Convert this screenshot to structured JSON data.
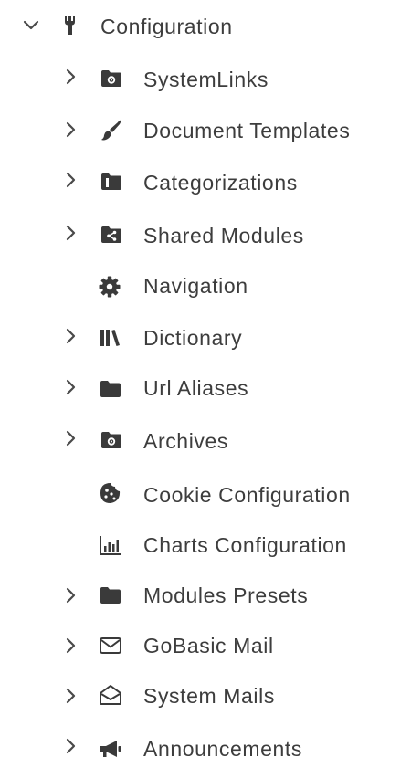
{
  "tree": {
    "root": {
      "label": "Configuration",
      "expanded": true,
      "icon": "wrench-icon"
    },
    "children": [
      {
        "label": "SystemLinks",
        "icon": "folder-gear-icon",
        "has_children": true
      },
      {
        "label": "Document Templates",
        "icon": "paintbrush-icon",
        "has_children": true
      },
      {
        "label": "Categorizations",
        "icon": "folder-tag-icon",
        "has_children": true
      },
      {
        "label": "Shared Modules",
        "icon": "folder-share-icon",
        "has_children": true
      },
      {
        "label": "Navigation",
        "icon": "gear-icon",
        "has_children": false
      },
      {
        "label": "Dictionary",
        "icon": "books-icon",
        "has_children": true
      },
      {
        "label": "Url Aliases",
        "icon": "folder-icon",
        "has_children": true
      },
      {
        "label": "Archives",
        "icon": "folder-gear-icon",
        "has_children": true
      },
      {
        "label": "Cookie Configuration",
        "icon": "cookie-icon",
        "has_children": false
      },
      {
        "label": "Charts Configuration",
        "icon": "bar-chart-icon",
        "has_children": false
      },
      {
        "label": "Modules Presets",
        "icon": "folder-icon",
        "has_children": true
      },
      {
        "label": "GoBasic Mail",
        "icon": "envelope-icon",
        "has_children": true
      },
      {
        "label": "System Mails",
        "icon": "envelope-open-icon",
        "has_children": true
      },
      {
        "label": "Announcements",
        "icon": "megaphone-icon",
        "has_children": true
      }
    ]
  },
  "colors": {
    "text": "#3d3d3d",
    "icon": "#3a3a3a",
    "chevron": "#4a4a4a",
    "background": "#ffffff"
  }
}
